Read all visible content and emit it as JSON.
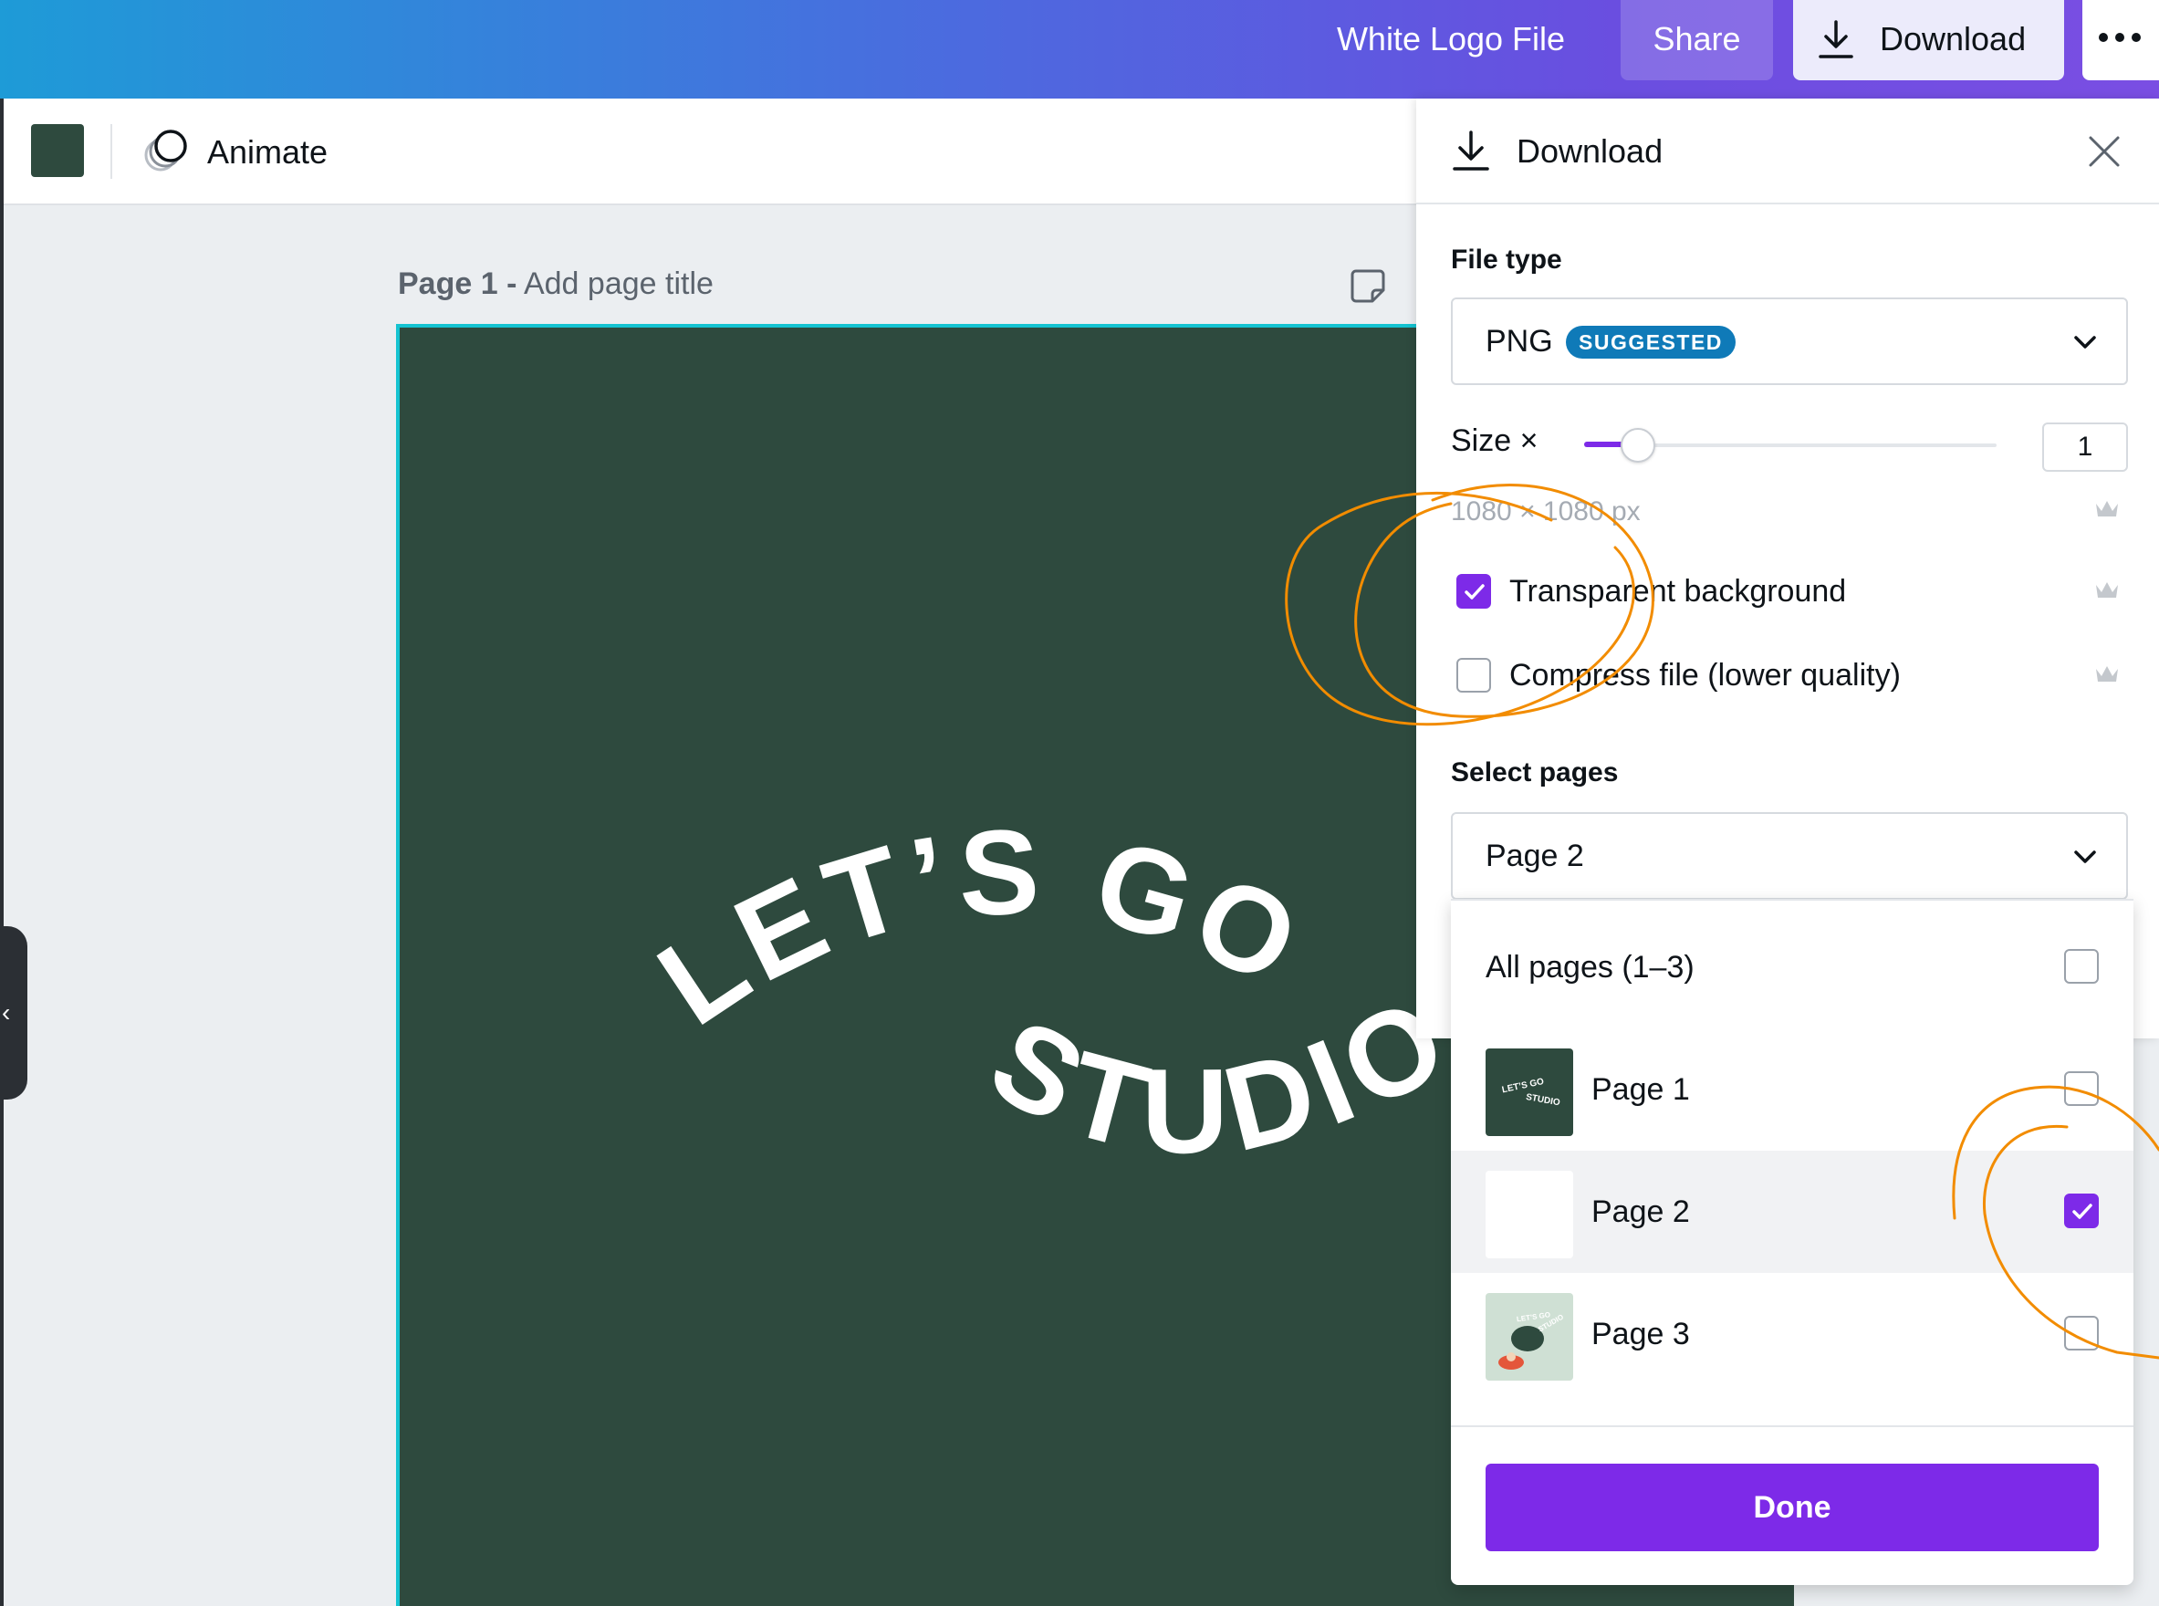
{
  "topbar": {
    "file_title": "White Logo File",
    "share_label": "Share",
    "download_label": "Download"
  },
  "toolbar": {
    "color_swatch": "#2e4a3e",
    "animate_label": "Animate"
  },
  "canvas": {
    "page_label_bold": "Page 1 -",
    "page_label_hint": "Add page title",
    "design_text_line1": "LET’S GO",
    "design_text_line2": "STUDIO",
    "design_bg": "#2e4a3e"
  },
  "download_panel": {
    "title": "Download",
    "file_type_label": "File type",
    "file_type_value": "PNG",
    "file_type_badge": "SUGGESTED",
    "size_label": "Size ×",
    "size_value": "1",
    "size_slider_fraction": 0.13,
    "dimensions": "1080 × 1080 px",
    "options": [
      {
        "label": "Transparent background",
        "checked": true
      },
      {
        "label": "Compress file (lower quality)",
        "checked": false
      }
    ],
    "select_pages_label": "Select pages",
    "select_pages_value": "Page 2"
  },
  "pages_dropdown": {
    "all_pages_label": "All pages (1–3)",
    "pages": [
      {
        "label": "Page 1",
        "checked": false,
        "thumb_text_1": "LET’S GO",
        "thumb_text_2": "STUDIO"
      },
      {
        "label": "Page 2",
        "checked": true
      },
      {
        "label": "Page 3",
        "checked": false,
        "thumb_text_1": "LET’S GO",
        "thumb_text_2": "STUDIO"
      }
    ],
    "done_label": "Done"
  },
  "colors": {
    "accent": "#7d2ae8",
    "badge": "#0f7ab8",
    "annotation": "#f28c00"
  }
}
